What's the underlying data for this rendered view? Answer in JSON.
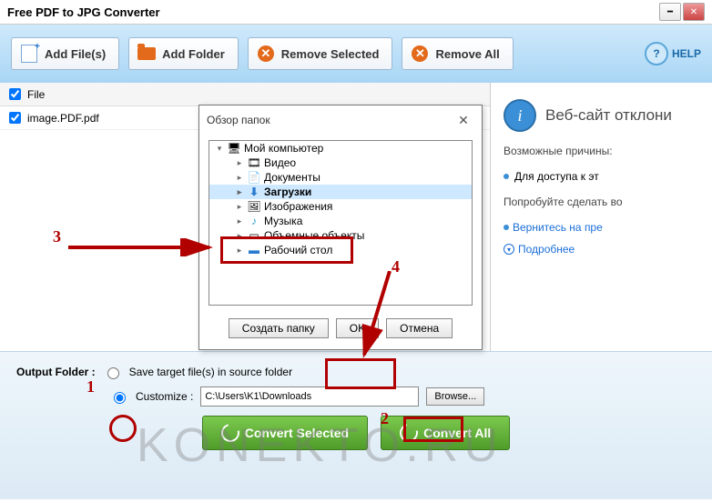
{
  "window": {
    "title": "Free PDF to JPG Converter"
  },
  "toolbar": {
    "add_file": "Add File(s)",
    "add_folder": "Add Folder",
    "remove_selected": "Remove Selected",
    "remove_all": "Remove All",
    "help": "HELP"
  },
  "filelist": {
    "header": "File",
    "items": [
      "image.PDF.pdf"
    ]
  },
  "sidebar": {
    "heading": "Веб-сайт отклони",
    "reasons_title": "Возможные причины:",
    "reason1": "Для доступа к эт",
    "try_title": "Попробуйте сделать во",
    "try_item": "Вернитесь на пре",
    "more": "Подробнее"
  },
  "output": {
    "title": "Output Folder :",
    "save_source": "Save target file(s) in source folder",
    "customize": "Customize :",
    "path": "C:\\Users\\K1\\Downloads",
    "browse": "Browse...",
    "convert_selected": "Convert Selected",
    "convert_all": "Convert All"
  },
  "dialog": {
    "title": "Обзор папок",
    "nodes": {
      "root": "Мой компьютер",
      "n1": "Видео",
      "n2": "Документы",
      "n3": "Загрузки",
      "n4": "Изображения",
      "n5": "Музыка",
      "n6": "Объемные объекты",
      "n7": "Рабочий стол"
    },
    "create": "Создать папку",
    "ok": "OK",
    "cancel": "Отмена"
  },
  "annotations": {
    "n1": "1",
    "n2": "2",
    "n3": "3",
    "n4": "4"
  },
  "watermark": "KONEKTO.RU"
}
